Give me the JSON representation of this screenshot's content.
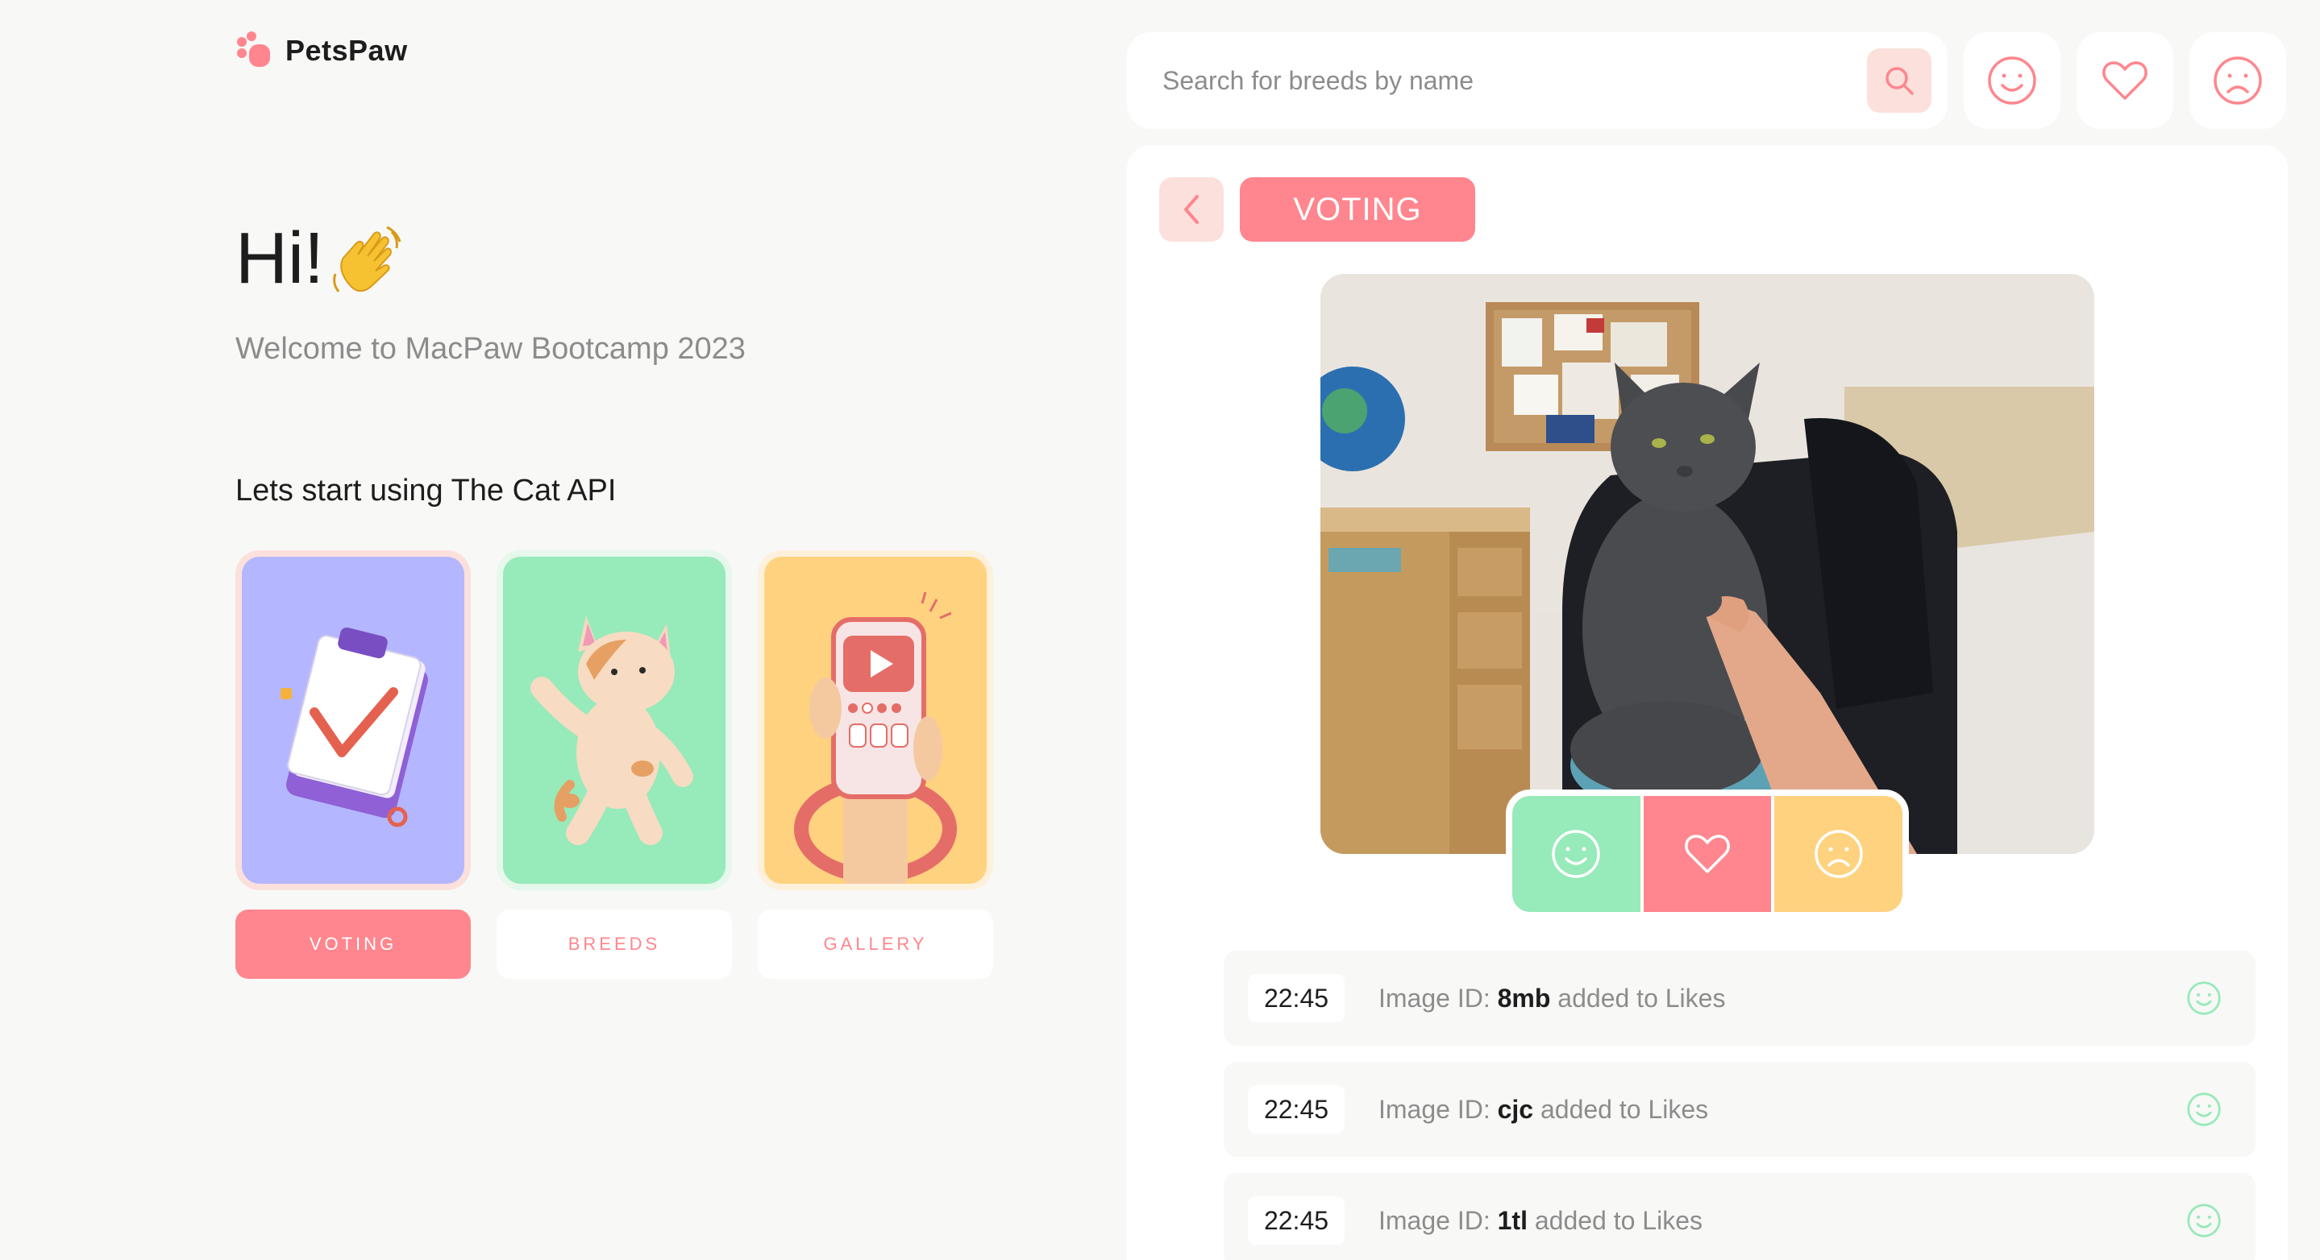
{
  "brand": {
    "name": "PetsPaw",
    "accent": "#ff868e"
  },
  "hero": {
    "greeting": "Hi!",
    "greeting_emoji": "👋",
    "subtitle": "Welcome to MacPaw Bootcamp 2023",
    "section_heading": "Lets start using The Cat API"
  },
  "nav_cards": [
    {
      "label": "VOTING",
      "active": true,
      "bg": "#b4b7ff",
      "icon": "clipboard-illustration"
    },
    {
      "label": "BREEDS",
      "active": false,
      "bg": "#97eab9",
      "icon": "cat-illustration"
    },
    {
      "label": "GALLERY",
      "active": false,
      "bg": "#ffd280",
      "icon": "phone-illustration"
    }
  ],
  "search": {
    "placeholder": "Search for breeds by name",
    "value": ""
  },
  "top_actions": [
    {
      "name": "likes",
      "icon": "smile-icon"
    },
    {
      "name": "favourites",
      "icon": "heart-icon"
    },
    {
      "name": "dislikes",
      "icon": "sad-icon"
    }
  ],
  "voting": {
    "section_label": "VOTING",
    "log": [
      {
        "time": "22:45",
        "prefix": "Image ID: ",
        "image_id": "8mb",
        "suffix": " added to Likes",
        "icon": "smile-icon"
      },
      {
        "time": "22:45",
        "prefix": "Image ID: ",
        "image_id": "cjc",
        "suffix": " added to Likes",
        "icon": "smile-icon"
      },
      {
        "time": "22:45",
        "prefix": "Image ID: ",
        "image_id": "1tl",
        "suffix": " added to Likes",
        "icon": "smile-icon"
      }
    ]
  },
  "colors": {
    "like": "#97eab9",
    "favourite": "#ff868e",
    "dislike": "#ffd280",
    "log_like_icon": "#97eab9"
  }
}
